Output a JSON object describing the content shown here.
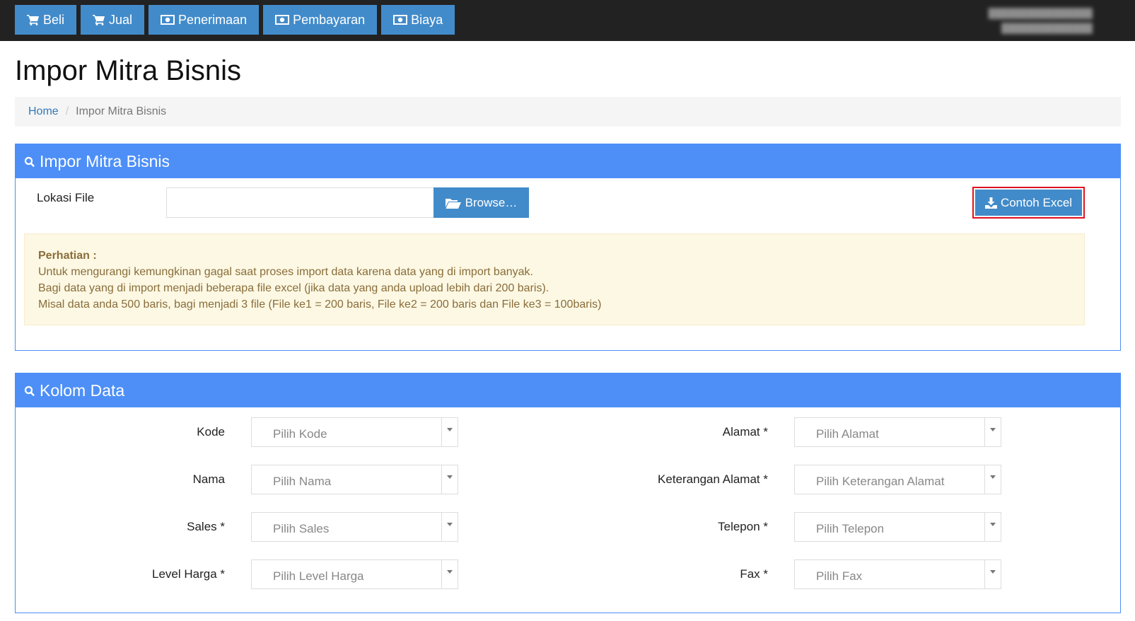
{
  "topnav": {
    "items": [
      {
        "label": "Beli",
        "icon": "cart-icon"
      },
      {
        "label": "Jual",
        "icon": "cart-icon"
      },
      {
        "label": "Penerimaan",
        "icon": "money-icon"
      },
      {
        "label": "Pembayaran",
        "icon": "money-icon"
      },
      {
        "label": "Biaya",
        "icon": "money-icon"
      }
    ]
  },
  "page": {
    "title": "Impor Mitra Bisnis"
  },
  "breadcrumb": {
    "home": "Home",
    "separator": "/",
    "current": "Impor Mitra Bisnis"
  },
  "import_panel": {
    "heading": "Impor Mitra Bisnis",
    "file_label": "Lokasi File",
    "file_value": "",
    "browse_label": "Browse…",
    "excel_label": "Contoh Excel",
    "alert": {
      "title": "Perhatian :",
      "lines": [
        "Untuk mengurangi kemungkinan gagal saat proses import data karena data yang di import banyak.",
        "Bagi data yang di import menjadi beberapa file excel (jika data yang anda upload lebih dari 200 baris).",
        "Misal data anda 500 baris, bagi menjadi 3 file (File ke1 = 200 baris, File ke2 = 200 baris dan File ke3 = 100baris)"
      ]
    }
  },
  "columns_panel": {
    "heading": "Kolom Data",
    "left_fields": [
      {
        "label": "Kode",
        "placeholder": "Pilih Kode"
      },
      {
        "label": "Nama",
        "placeholder": "Pilih Nama"
      },
      {
        "label": "Sales *",
        "placeholder": "Pilih Sales"
      },
      {
        "label": "Level Harga *",
        "placeholder": "Pilih Level Harga"
      }
    ],
    "right_fields": [
      {
        "label": "Alamat *",
        "placeholder": "Pilih Alamat"
      },
      {
        "label": "Keterangan Alamat *",
        "placeholder": "Pilih Keterangan Alamat"
      },
      {
        "label": "Telepon *",
        "placeholder": "Pilih Telepon"
      },
      {
        "label": "Fax *",
        "placeholder": "Pilih Fax"
      }
    ]
  },
  "colors": {
    "navbar": "#222222",
    "primary_button": "#428bca",
    "panel_header": "#4d8ff7",
    "highlight_border": "#e0121e",
    "alert_bg": "#fcf8e3"
  }
}
